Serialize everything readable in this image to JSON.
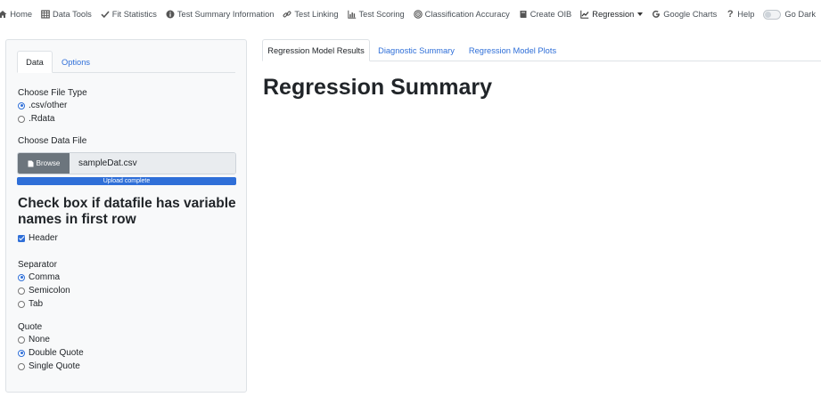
{
  "navbar": {
    "items": [
      {
        "label": "Home",
        "icon": "home-icon"
      },
      {
        "label": "Data Tools",
        "icon": "table-icon"
      },
      {
        "label": "Fit Statistics",
        "icon": "check-icon"
      },
      {
        "label": "Test Summary Information",
        "icon": "info-circle-icon"
      },
      {
        "label": "Test Linking",
        "icon": "link-icon"
      },
      {
        "label": "Test Scoring",
        "icon": "bar-chart-icon"
      },
      {
        "label": "Classification Accuracy",
        "icon": "bullseye-icon"
      },
      {
        "label": "Create OIB",
        "icon": "book-icon"
      },
      {
        "label": "Regression",
        "icon": "line-chart-icon"
      },
      {
        "label": "Google Charts",
        "icon": "google-icon"
      },
      {
        "label": "Help",
        "icon": "question-icon"
      }
    ],
    "dark_toggle_label": "Go Dark"
  },
  "sidebar": {
    "tabs": {
      "data": "Data",
      "options": "Options"
    },
    "file_type": {
      "label": "Choose File Type",
      "options": [
        ".csv/other",
        ".Rdata"
      ],
      "selected": ".csv/other"
    },
    "data_file": {
      "label": "Choose Data File",
      "browse_label": "Browse",
      "file_name": "sampleDat.csv",
      "progress_label": "Upload complete",
      "progress": 1.0
    },
    "header_heading": "Check box if datafile has variable names in first row",
    "header_checkbox": {
      "label": "Header",
      "checked": true
    },
    "separator": {
      "label": "Separator",
      "options": [
        "Comma",
        "Semicolon",
        "Tab"
      ],
      "selected": "Comma"
    },
    "quote": {
      "label": "Quote",
      "options": [
        "None",
        "Double Quote",
        "Single Quote"
      ],
      "selected": "Double Quote"
    }
  },
  "main": {
    "tabs": [
      "Regression Model Results",
      "Diagnostic Summary",
      "Regression Model Plots"
    ],
    "title": "Regression Summary"
  },
  "colors": {
    "accent": "#2f6fd8",
    "browse": "#6c757d",
    "panel": "#f8f9fa"
  }
}
